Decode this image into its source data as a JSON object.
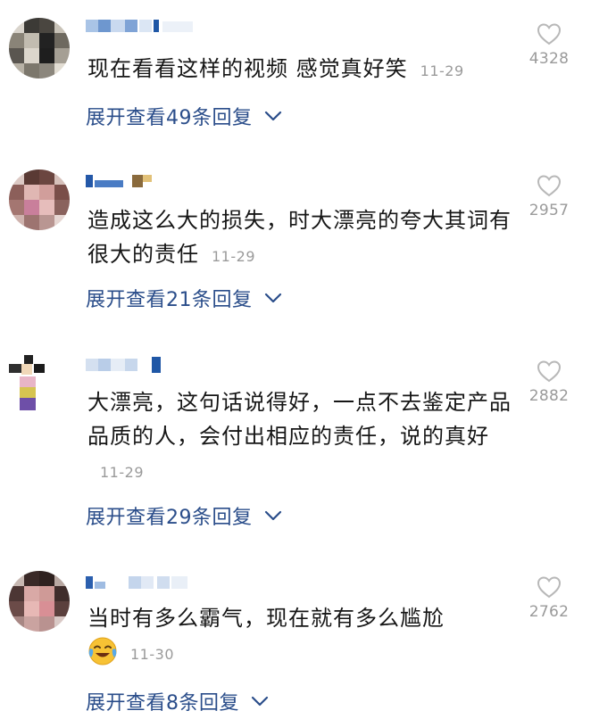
{
  "comments": [
    {
      "text": "现在看看这样的视频 感觉真好笑",
      "time": "11-29",
      "replies_label": "展开查看49条回复",
      "likes": "4328",
      "name_partial": "熊猫"
    },
    {
      "text": "造成这么大的损失，时大漂亮的夸大其词有很大的责任",
      "time": "11-29",
      "replies_label": "展开查看21条回复",
      "likes": "2957"
    },
    {
      "text": "大漂亮，这句话说得好，一点不去鉴定产品品质的人，会付出相应的责任，说的真好",
      "time": "11-29",
      "replies_label": "展开查看29条回复",
      "likes": "2882"
    },
    {
      "text": "当时有多么霸气，现在就有多么尴尬",
      "emoji": "crying-laughing-emoji",
      "time": "11-30",
      "replies_label": "展开查看8条回复",
      "likes": "2762"
    }
  ],
  "colors": {
    "text": "#161616",
    "time": "#9a9a9a",
    "reply_link": "#2a4d8a",
    "icon_gray": "#b8b8b8"
  },
  "icons": {
    "like": "heart-outline-icon",
    "expand": "chevron-down-icon"
  }
}
